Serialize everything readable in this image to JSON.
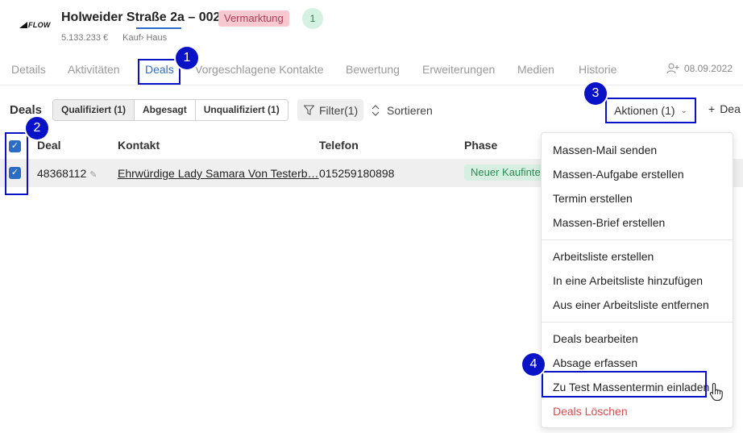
{
  "header": {
    "logo_text": "FLOW",
    "title": "Holweider Straße 2a – 002",
    "status_badge": "Vermarktung",
    "count_badge": "1",
    "price": "5.133.233 €",
    "type": "Kauf› Haus"
  },
  "tabs": [
    {
      "label": "Details"
    },
    {
      "label": "Aktivitäten"
    },
    {
      "label": "Deals"
    },
    {
      "label": "Vorgeschlagene Kontakte"
    },
    {
      "label": "Bewertung"
    },
    {
      "label": "Erweiterungen"
    },
    {
      "label": "Medien"
    },
    {
      "label": "Historie"
    }
  ],
  "tab_date": "08.09.2022",
  "toolbar": {
    "title": "Deals",
    "segments": [
      "Qualifiziert (1)",
      "Abgesagt",
      "Unqualifiziert (1)"
    ],
    "filter_label": "Filter(1)",
    "sort_label": "Sortieren",
    "actions_label": "Aktionen (1)",
    "add_label": "Dea"
  },
  "table": {
    "columns": [
      "Deal",
      "Kontakt",
      "Telefon",
      "Phase"
    ],
    "rows": [
      {
        "deal": "48368112",
        "contact": "Ehrwürdige Lady Samara Von Testerb…",
        "phone": "015259180898",
        "phase": "Neuer Kaufinte"
      }
    ]
  },
  "dropdown": {
    "group1": [
      "Massen-Mail senden",
      "Massen-Aufgabe erstellen",
      "Termin erstellen",
      "Massen-Brief erstellen"
    ],
    "group2": [
      "Arbeitsliste erstellen",
      "In eine Arbeitsliste hinzufügen",
      "Aus einer Arbeitsliste entfernen"
    ],
    "group3": [
      "Deals bearbeiten",
      "Absage erfassen",
      "Zu Test Massentermin einladen"
    ],
    "danger": "Deals Löschen"
  },
  "markers": [
    "1",
    "2",
    "3",
    "4"
  ],
  "colors": {
    "accent": "#2b6cc4",
    "annotation": "#0a12c8",
    "danger": "#e0474a",
    "status_badge_bg": "#f6c9d1",
    "phase_badge_bg": "#d6efe1"
  },
  "icons": [
    "filter-icon",
    "sort-icon",
    "chevron-down-icon",
    "plus-icon",
    "add-user-icon",
    "pencil-icon",
    "checkbox-icon",
    "hand-cursor-icon"
  ]
}
